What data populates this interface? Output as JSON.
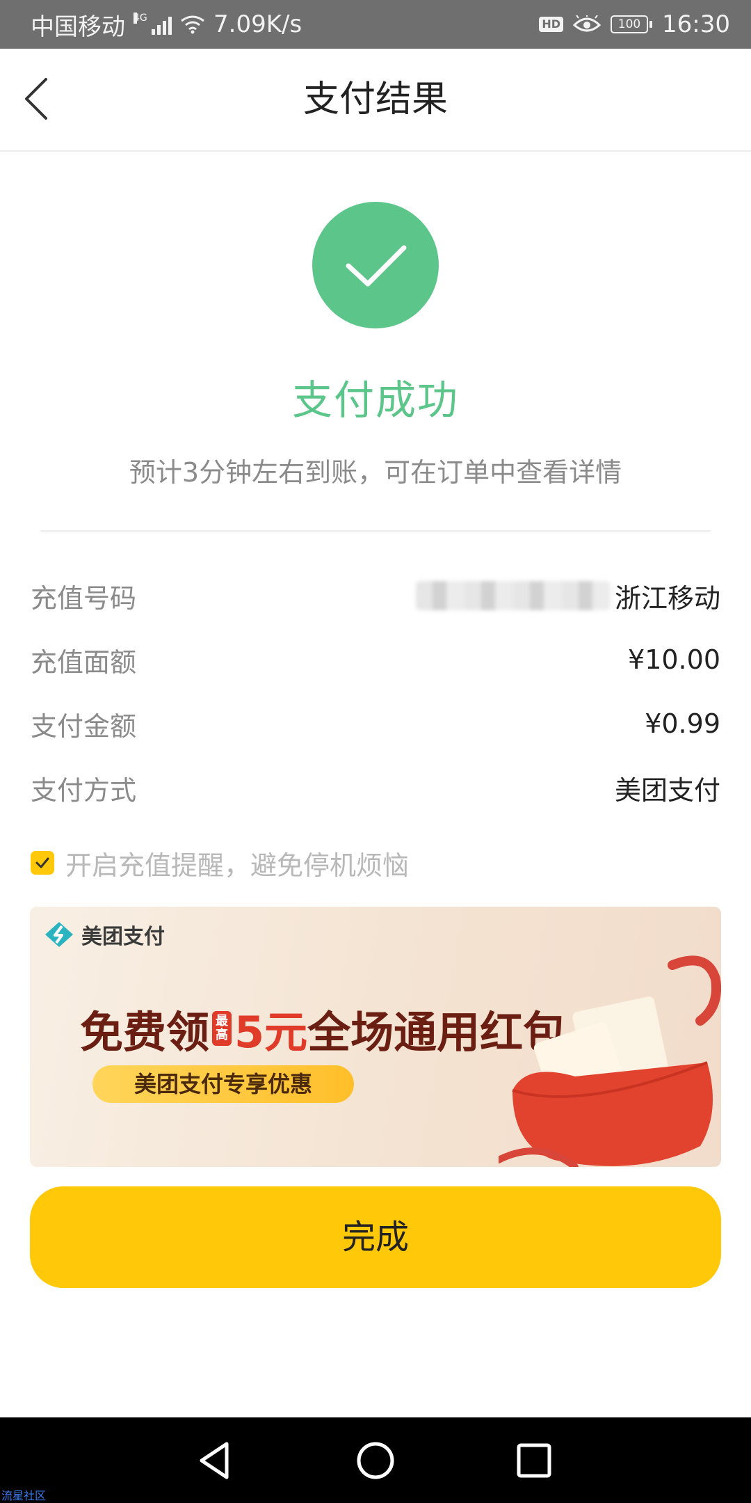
{
  "status_bar": {
    "carrier": "中国移动",
    "network_type": "4G",
    "speed": "7.09K/s",
    "hd_badge": "HD",
    "battery": "100",
    "time": "16:30"
  },
  "header": {
    "title": "支付结果",
    "back_icon": "chevron-left-icon"
  },
  "result": {
    "icon": "check-circle-icon",
    "title": "支付成功",
    "subtitle": "预计3分钟左右到账，可在订单中查看详情",
    "accent_color": "#5cc58a"
  },
  "details": [
    {
      "label": "充值号码",
      "value": "浙江移动"
    },
    {
      "label": "充值面额",
      "value": "¥10.00"
    },
    {
      "label": "支付金额",
      "value": "¥0.99"
    },
    {
      "label": "支付方式",
      "value": "美团支付"
    }
  ],
  "reminder": {
    "checked": true,
    "text": "开启充值提醒，避免停机烦恼"
  },
  "banner": {
    "logo_text": "美团支付",
    "headline_part1": "免费领",
    "max_tag_line1": "最",
    "max_tag_line2": "高",
    "headline_amount": "5元",
    "headline_part2": "全场通用红包",
    "pill_text": "美团支付专享优惠"
  },
  "done_button": {
    "label": "完成",
    "color": "#ffc808"
  },
  "nav_bar": {
    "back_icon": "nav-back-triangle-icon",
    "home_icon": "nav-home-circle-icon",
    "recents_icon": "nav-recents-square-icon"
  },
  "watermark": "流星社区"
}
